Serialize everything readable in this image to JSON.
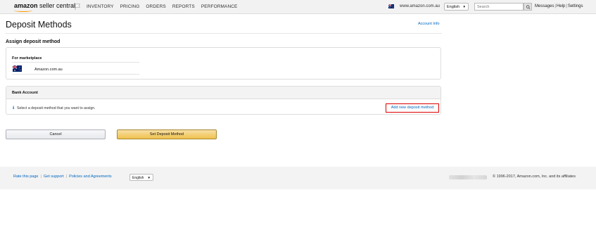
{
  "header": {
    "logo_bold": "amazon",
    "logo_light": " seller central",
    "nav": [
      "INVENTORY",
      "PRICING",
      "ORDERS",
      "REPORTS",
      "PERFORMANCE"
    ],
    "marketplace_url": "www.amazon.com.au",
    "language": "English",
    "search_placeholder": "Search",
    "links": [
      "Messages",
      "Help",
      "Settings"
    ]
  },
  "page": {
    "title": "Deposit Methods",
    "account_info": "Account Info",
    "section_title": "Assign deposit method",
    "marketplace_label": "For marketplace",
    "marketplace_name": "Amazon.com.au",
    "bank_title": "Bank Account",
    "bank_message": "Select a deposit method that you want to assign.",
    "add_link": "Add new deposit method",
    "cancel_label": "Cancel",
    "set_label": "Set Deposit Method"
  },
  "footer": {
    "links": [
      "Rate this page",
      "Get support",
      "Policies and Agreements"
    ],
    "language": "English",
    "copyright": "© 1996-2017, Amazon.com, Inc. and its affiliates"
  },
  "colors": {
    "link": "#0066c0",
    "primary_button": "#f0c14b",
    "highlight_border": "#dd0000"
  }
}
